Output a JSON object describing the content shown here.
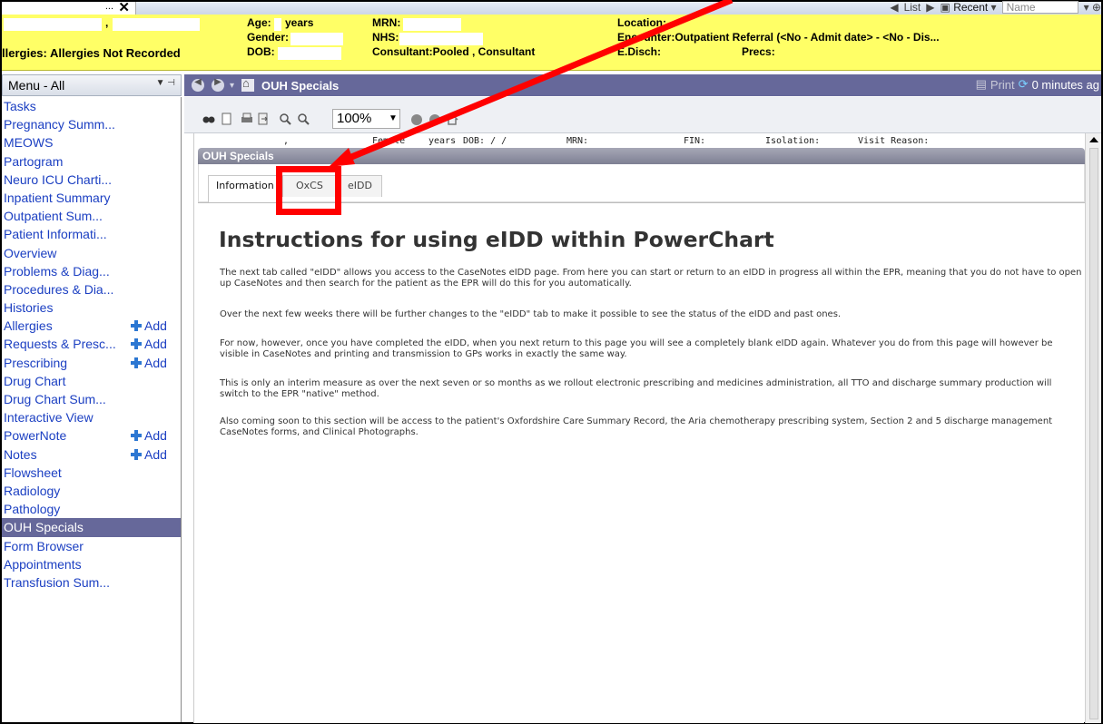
{
  "banner": {
    "close_dots": "...",
    "age_label": "Age:",
    "age_unit": "years",
    "gender_label": "Gender:",
    "dob_label": "DOB:",
    "mrn_label": "MRN:",
    "nhs_label": "NHS:",
    "consultant": "Consultant:Pooled , Consultant",
    "location_label": "Location:",
    "encounter": "Encounter:Outpatient Referral (<No - Admit date> - <No - Dis...",
    "edisch_label": "E.Disch:",
    "precs_label": "Precs:",
    "allergies": "llergies: Allergies Not Recorded",
    "name_comma": ",",
    "top_list": "List",
    "top_recent": "Recent",
    "top_name_placeholder": "Name"
  },
  "menu": {
    "title": "Menu - All",
    "items": [
      {
        "label": "Tasks"
      },
      {
        "label": "Pregnancy Summ..."
      },
      {
        "label": "MEOWS"
      },
      {
        "label": "Partogram"
      },
      {
        "label": "Neuro ICU Charti..."
      },
      {
        "label": "Inpatient Summary"
      },
      {
        "label": "Outpatient Sum..."
      },
      {
        "label": "Patient Informati..."
      },
      {
        "label": "Overview"
      },
      {
        "label": "Problems & Diag..."
      },
      {
        "label": "Procedures & Dia..."
      },
      {
        "label": "Histories"
      },
      {
        "label": "Allergies",
        "add": "Add"
      },
      {
        "label": "Requests & Presc...",
        "add": "Add"
      },
      {
        "label": "Prescribing",
        "add": "Add"
      },
      {
        "label": "Drug Chart"
      },
      {
        "label": "Drug Chart Sum..."
      },
      {
        "label": "Interactive View"
      },
      {
        "label": "PowerNote",
        "add": "Add"
      },
      {
        "label": "Notes",
        "add": "Add"
      },
      {
        "label": "Flowsheet"
      },
      {
        "label": "Radiology"
      },
      {
        "label": "Pathology"
      },
      {
        "label": "OUH Specials",
        "active": true
      },
      {
        "label": "Form Browser"
      },
      {
        "label": "Appointments"
      },
      {
        "label": "Transfusion Sum..."
      }
    ]
  },
  "nav": {
    "title": "OUH Specials",
    "print": "Print",
    "refresh": "0 minutes ag"
  },
  "toolbar": {
    "zoom": "100%"
  },
  "patient_strip": {
    "comma": ",",
    "sex": "Female",
    "years": "years",
    "dob": "DOB:  /  /",
    "mrn": "MRN:",
    "fin": "FIN:",
    "isolation": "Isolation:",
    "visit_reason": "Visit Reason:"
  },
  "panel": {
    "header": "OUH Specials",
    "tabs": [
      "Information",
      "OxCS",
      "eIDD"
    ],
    "heading": "Instructions for using eIDD within PowerChart",
    "paragraphs": [
      "The next tab called \"eIDD\" allows you access to the CaseNotes eIDD page. From here you can start or return to an eIDD in progress all within the EPR, meaning that you do not have to open up CaseNotes and then search for the patient as the EPR will do this for you automatically.",
      "Over the next few weeks there will be further changes to the \"eIDD\" tab to make it possible to see the status of the eIDD and past ones.",
      "For now, however, once you have completed the eIDD, when you next return to this page you will see a completely blank eIDD again. Whatever you do from this page will however be visible in CaseNotes and printing and transmission to GPs works in exactly the same way.",
      "This is only an interim measure as over the next seven or so months as we rollout electronic prescribing and medicines administration, all TTO and discharge summary production will switch to the EPR \"native\" method.",
      "Also coming soon to this section will be access to the patient's Oxfordshire Care Summary Record, the Aria chemotherapy prescribing system, Section 2 and 5 discharge management CaseNotes forms, and Clinical Photographs."
    ]
  },
  "colors": {
    "banner": "#ffff66",
    "nav": "#66689a",
    "link": "#1b3fc2",
    "annotation": "#ff0000"
  }
}
